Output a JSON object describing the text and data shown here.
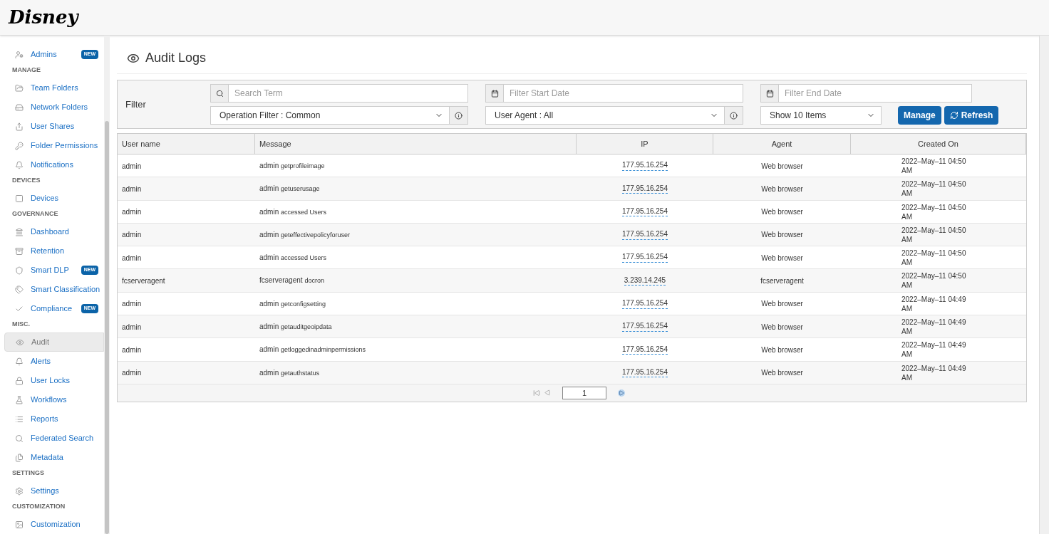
{
  "header": {
    "logo": "Disney"
  },
  "sidebar": {
    "items": [
      {
        "kind": "item",
        "label": "Admins",
        "badge": "NEW",
        "selected": false
      },
      {
        "kind": "section",
        "label": "MANAGE"
      },
      {
        "kind": "item",
        "label": "Team Folders",
        "selected": false
      },
      {
        "kind": "item",
        "label": "Network Folders",
        "selected": false
      },
      {
        "kind": "item",
        "label": "User Shares",
        "selected": false
      },
      {
        "kind": "item",
        "label": "Folder Permissions",
        "selected": false
      },
      {
        "kind": "item",
        "label": "Notifications",
        "selected": false
      },
      {
        "kind": "section",
        "label": "DEVICES"
      },
      {
        "kind": "item",
        "label": "Devices",
        "selected": false
      },
      {
        "kind": "section",
        "label": "GOVERNANCE"
      },
      {
        "kind": "item",
        "label": "Dashboard",
        "selected": false
      },
      {
        "kind": "item",
        "label": "Retention",
        "selected": false
      },
      {
        "kind": "item",
        "label": "Smart DLP",
        "badge": "NEW",
        "selected": false
      },
      {
        "kind": "item",
        "label": "Smart Classification",
        "selected": false
      },
      {
        "kind": "item",
        "label": "Compliance",
        "badge": "NEW",
        "selected": false
      },
      {
        "kind": "section",
        "label": "MISC."
      },
      {
        "kind": "item",
        "label": "Audit",
        "selected": true
      },
      {
        "kind": "item",
        "label": "Alerts",
        "selected": false
      },
      {
        "kind": "item",
        "label": "User Locks",
        "selected": false
      },
      {
        "kind": "item",
        "label": "Workflows",
        "selected": false
      },
      {
        "kind": "item",
        "label": "Reports",
        "selected": false
      },
      {
        "kind": "item",
        "label": "Federated Search",
        "selected": false
      },
      {
        "kind": "item",
        "label": "Metadata",
        "selected": false
      },
      {
        "kind": "section",
        "label": "SETTINGS"
      },
      {
        "kind": "item",
        "label": "Settings",
        "selected": false
      },
      {
        "kind": "section",
        "label": "CUSTOMIZATION"
      },
      {
        "kind": "item",
        "label": "Customization",
        "selected": false
      }
    ]
  },
  "page": {
    "title": "Audit Logs"
  },
  "filter": {
    "label": "Filter",
    "search": {
      "placeholder": "Search Term"
    },
    "start_date": {
      "placeholder": "Filter Start Date"
    },
    "end_date": {
      "placeholder": "Filter End Date"
    },
    "operation_filter": "Operation Filter : Common",
    "user_agent": "User Agent : All",
    "page_size": "Show 10 Items",
    "buttons": [
      "Manage",
      "Refresh"
    ]
  },
  "table": {
    "columns": [
      "User name",
      "Message",
      "IP",
      "Agent",
      "Created On"
    ],
    "rows": [
      {
        "user": "admin",
        "actor": "admin",
        "action": "getprofileimage",
        "ip": "177.95.16.254",
        "agent": "Web browser",
        "created": "2022–May–11 04:50 AM"
      },
      {
        "user": "admin",
        "actor": "admin",
        "action": "getuserusage",
        "ip": "177.95.16.254",
        "agent": "Web browser",
        "created": "2022–May–11 04:50 AM"
      },
      {
        "user": "admin",
        "actor": "admin",
        "action": "accessed Users",
        "ip": "177.95.16.254",
        "agent": "Web browser",
        "created": "2022–May–11 04:50 AM"
      },
      {
        "user": "admin",
        "actor": "admin",
        "action": "geteffectivepolicyforuser",
        "ip": "177.95.16.254",
        "agent": "Web browser",
        "created": "2022–May–11 04:50 AM"
      },
      {
        "user": "admin",
        "actor": "admin",
        "action": "accessed Users",
        "ip": "177.95.16.254",
        "agent": "Web browser",
        "created": "2022–May–11 04:50 AM"
      },
      {
        "user": "fcserveragent",
        "actor": "fcserveragent",
        "action": "docron",
        "ip": "3.239.14.245",
        "agent": "fcserveragent",
        "created": "2022–May–11 04:50 AM"
      },
      {
        "user": "admin",
        "actor": "admin",
        "action": "getconfigsetting",
        "ip": "177.95.16.254",
        "agent": "Web browser",
        "created": "2022–May–11 04:49 AM"
      },
      {
        "user": "admin",
        "actor": "admin",
        "action": "getauditgeoipdata",
        "ip": "177.95.16.254",
        "agent": "Web browser",
        "created": "2022–May–11 04:49 AM"
      },
      {
        "user": "admin",
        "actor": "admin",
        "action": "getloggedinadminpermissions",
        "ip": "177.95.16.254",
        "agent": "Web browser",
        "created": "2022–May–11 04:49 AM"
      },
      {
        "user": "admin",
        "actor": "admin",
        "action": "getauthstatus",
        "ip": "177.95.16.254",
        "agent": "Web browser",
        "created": "2022–May–11 04:49 AM"
      }
    ]
  },
  "pagination": {
    "page": "1"
  }
}
